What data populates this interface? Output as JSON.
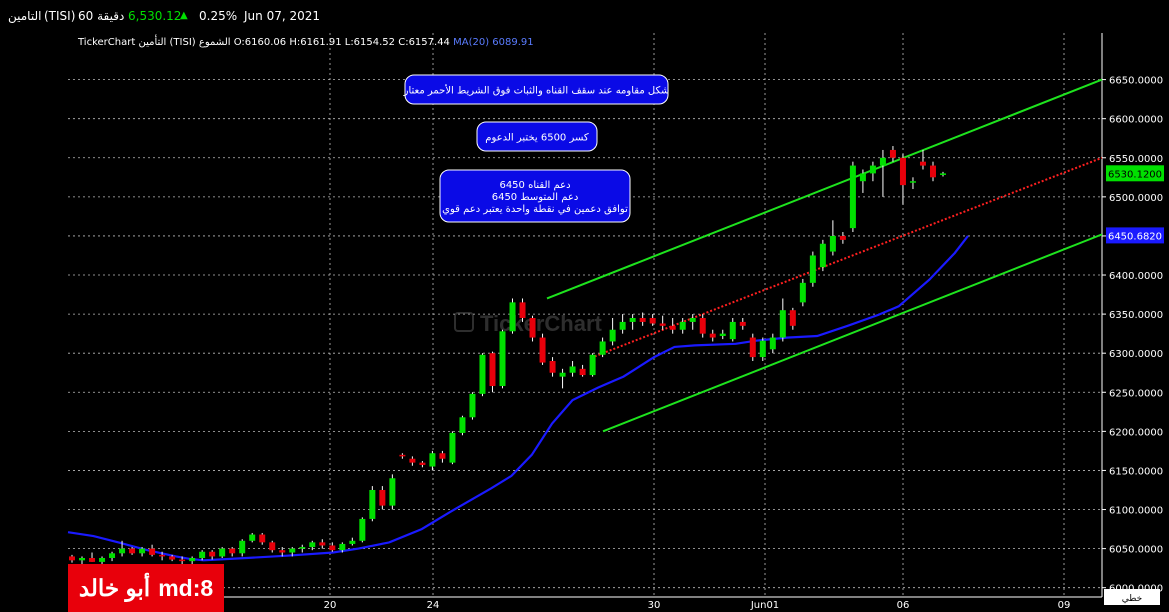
{
  "topbar": {
    "name": "التامين",
    "symbol": "(TISI)",
    "interval": "60 دقيقة",
    "price": "6,530.12",
    "change": "0.25%",
    "date": "Jun 07, 2021"
  },
  "header": {
    "brand": "TickerChart",
    "name": "التأمين",
    "symbol": "(TISI)",
    "ohlc_label": "الشموع",
    "ohlc": "O:6160.06 H:6161.91 L:6154.52 C:6157.44",
    "ma_label": "MA(20)",
    "ma_value": "6089.91"
  },
  "watermark": "TickerChart",
  "annotations": {
    "a1": "شكل مقاومه عند سقف القناه والثبات فوق الشريط الأحمر معتار",
    "a2": "كسر  6500  يختبر الدعوم",
    "a3_l1": "دعم القناه 6450",
    "a3_l2": "دعم المتوسط 6450",
    "a3_l3": "توافق دعمين في نقطة واحدة يعتبر دعم قوي"
  },
  "signature": {
    "word": "md:8",
    "name": "أبو خالد"
  },
  "scale_mode": "خطي",
  "colors": {
    "up": "#00e000",
    "down": "#e8000b",
    "ma": "#1a1aff",
    "channel": "#1ee31e",
    "trend": "#ff2020"
  },
  "chart_data": {
    "type": "candlestick",
    "x_ticks": [
      "20",
      "24",
      "30",
      "Jun01",
      "06",
      "09"
    ],
    "y_ticks": [
      "6000.0000",
      "6050.0000",
      "6100.0000",
      "6150.0000",
      "6200.0000",
      "6250.0000",
      "6300.0000",
      "6350.0000",
      "6400.0000",
      "6450.0000",
      "6500.0000",
      "6550.0000",
      "6600.0000",
      "6650.0000"
    ],
    "ylim": [
      5995,
      6680
    ],
    "price_labels": [
      {
        "text": "6530.1200",
        "value": 6530.12,
        "color": "#00e000"
      },
      {
        "text": "6450.6820",
        "value": 6450.68,
        "color": "#1a1aff"
      }
    ],
    "candles": [
      [
        6040,
        6042,
        6032,
        6035
      ],
      [
        6035,
        6040,
        6030,
        6038
      ],
      [
        6038,
        6045,
        6033,
        6033
      ],
      [
        6033,
        6040,
        6030,
        6038
      ],
      [
        6038,
        6046,
        6034,
        6044
      ],
      [
        6044,
        6060,
        6040,
        6050
      ],
      [
        6050,
        6052,
        6042,
        6044
      ],
      [
        6044,
        6052,
        6040,
        6050
      ],
      [
        6050,
        6055,
        6040,
        6042
      ],
      [
        6042,
        6046,
        6035,
        6040
      ],
      [
        6040,
        6042,
        6034,
        6036
      ],
      [
        6036,
        6040,
        6030,
        6034
      ],
      [
        6034,
        6040,
        6030,
        6038
      ],
      [
        6038,
        6048,
        6035,
        6046
      ],
      [
        6046,
        6048,
        6036,
        6040
      ],
      [
        6040,
        6052,
        6038,
        6050
      ],
      [
        6050,
        6052,
        6040,
        6044
      ],
      [
        6044,
        6062,
        6040,
        6060
      ],
      [
        6060,
        6070,
        6058,
        6068
      ],
      [
        6068,
        6070,
        6055,
        6058
      ],
      [
        6058,
        6060,
        6045,
        6048
      ],
      [
        6048,
        6052,
        6040,
        6045
      ],
      [
        6045,
        6052,
        6040,
        6050
      ],
      [
        6050,
        6055,
        6045,
        6052
      ],
      [
        6052,
        6060,
        6048,
        6058
      ],
      [
        6058,
        6062,
        6050,
        6054
      ],
      [
        6054,
        6058,
        6046,
        6048
      ],
      [
        6048,
        6058,
        6045,
        6056
      ],
      [
        6056,
        6064,
        6054,
        6060
      ],
      [
        6060,
        6090,
        6058,
        6088
      ],
      [
        6088,
        6130,
        6085,
        6125
      ],
      [
        6125,
        6130,
        6100,
        6105
      ],
      [
        6105,
        6145,
        6100,
        6140
      ],
      [
        6170,
        6172,
        6165,
        6168
      ],
      [
        6165,
        6168,
        6156,
        6160
      ],
      [
        6160,
        6162,
        6154,
        6157
      ],
      [
        6155,
        6175,
        6150,
        6172
      ],
      [
        6172,
        6175,
        6160,
        6165
      ],
      [
        6160,
        6200,
        6158,
        6198
      ],
      [
        6198,
        6220,
        6195,
        6218
      ],
      [
        6218,
        6250,
        6215,
        6248
      ],
      [
        6248,
        6300,
        6245,
        6298
      ],
      [
        6300,
        6302,
        6250,
        6258
      ],
      [
        6258,
        6330,
        6255,
        6328
      ],
      [
        6328,
        6370,
        6325,
        6365
      ],
      [
        6365,
        6370,
        6340,
        6345
      ],
      [
        6345,
        6348,
        6315,
        6320
      ],
      [
        6320,
        6325,
        6285,
        6288
      ],
      [
        6290,
        6295,
        6270,
        6275
      ],
      [
        6270,
        6280,
        6255,
        6275
      ],
      [
        6275,
        6290,
        6270,
        6283
      ],
      [
        6280,
        6285,
        6270,
        6272
      ],
      [
        6272,
        6300,
        6270,
        6298
      ],
      [
        6298,
        6320,
        6295,
        6315
      ],
      [
        6315,
        6345,
        6310,
        6330
      ],
      [
        6330,
        6350,
        6325,
        6340
      ],
      [
        6340,
        6350,
        6330,
        6345
      ],
      [
        6345,
        6352,
        6335,
        6340
      ],
      [
        6345,
        6350,
        6335,
        6338
      ],
      [
        6338,
        6348,
        6330,
        6335
      ],
      [
        6335,
        6345,
        6325,
        6330
      ],
      [
        6330,
        6345,
        6325,
        6340
      ],
      [
        6340,
        6350,
        6330,
        6345
      ],
      [
        6345,
        6350,
        6320,
        6325
      ],
      [
        6325,
        6330,
        6315,
        6320
      ],
      [
        6322,
        6330,
        6318,
        6325
      ],
      [
        6318,
        6345,
        6315,
        6340
      ],
      [
        6340,
        6345,
        6330,
        6335
      ],
      [
        6320,
        6325,
        6290,
        6295
      ],
      [
        6295,
        6320,
        6290,
        6316
      ],
      [
        6305,
        6325,
        6300,
        6320
      ],
      [
        6320,
        6370,
        6315,
        6355
      ],
      [
        6355,
        6358,
        6330,
        6335
      ],
      [
        6365,
        6395,
        6360,
        6390
      ],
      [
        6390,
        6430,
        6385,
        6425
      ],
      [
        6410,
        6445,
        6405,
        6440
      ],
      [
        6430,
        6470,
        6425,
        6450
      ],
      [
        6450,
        6455,
        6440,
        6445
      ],
      [
        6460,
        6545,
        6455,
        6540
      ],
      [
        6520,
        6535,
        6505,
        6530
      ],
      [
        6530,
        6545,
        6520,
        6540
      ],
      [
        6540,
        6560,
        6500,
        6550
      ],
      [
        6560,
        6565,
        6545,
        6550
      ],
      [
        6550,
        6555,
        6490,
        6515
      ],
      [
        6520,
        6525,
        6510,
        6520
      ],
      [
        6545,
        6560,
        6535,
        6540
      ],
      [
        6540,
        6545,
        6520,
        6525
      ],
      [
        6528,
        6532,
        6526,
        6530
      ]
    ],
    "ma_points": [
      [
        6085,
        6071
      ],
      [
        6110,
        6066
      ],
      [
        6137,
        6057
      ],
      [
        6163,
        6048
      ],
      [
        6191,
        6040
      ],
      [
        6204,
        6037
      ],
      [
        6218,
        6035
      ],
      [
        6260,
        6038
      ],
      [
        6300,
        6041
      ],
      [
        6345,
        6045
      ],
      [
        6370,
        6050
      ],
      [
        6400,
        6058
      ],
      [
        6432,
        6075
      ],
      [
        6460,
        6097
      ],
      [
        6500,
        6127
      ],
      [
        6520,
        6143
      ],
      [
        6540,
        6170
      ],
      [
        6560,
        6210
      ],
      [
        6580,
        6240
      ],
      [
        6605,
        6256
      ],
      [
        6630,
        6270
      ],
      [
        6660,
        6295
      ],
      [
        6680,
        6308
      ],
      [
        6700,
        6310
      ],
      [
        6740,
        6312
      ],
      [
        6760,
        6316
      ],
      [
        6790,
        6320
      ],
      [
        6820,
        6322
      ],
      [
        6850,
        6335
      ],
      [
        6880,
        6349
      ],
      [
        6900,
        6360
      ],
      [
        6930,
        6394
      ],
      [
        6955,
        6428
      ],
      [
        6968,
        6450
      ]
    ],
    "ma_x_ticks": [
      20.0,
      24.0,
      30.0,
      31.6,
      36.0,
      39.0
    ],
    "trend_line": {
      "from": [
        "May28",
        6294
      ],
      "to": [
        "Jun09+",
        6550
      ]
    },
    "channel_upper": {
      "from": [
        "May27",
        6370
      ],
      "to": [
        "Jun09+",
        6650
      ]
    },
    "channel_lower": {
      "from": [
        "May28",
        6200
      ],
      "to": [
        "Jun09+",
        6452
      ]
    }
  }
}
